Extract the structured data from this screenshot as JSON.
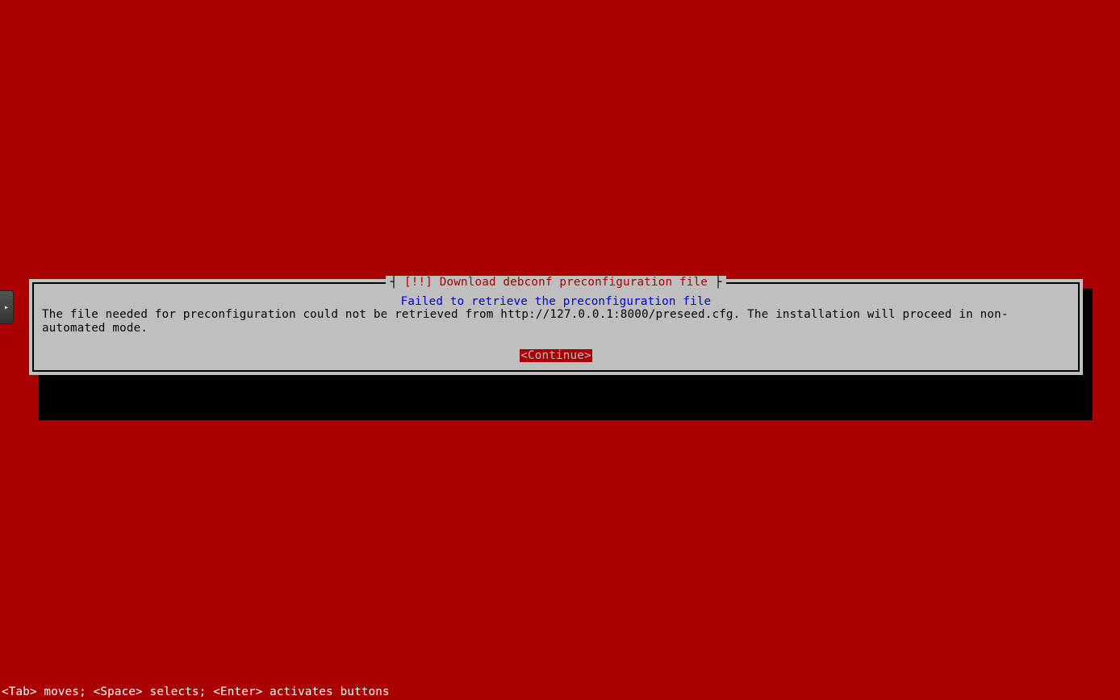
{
  "dialog": {
    "title": "[!!] Download debconf preconfiguration file",
    "subtitle": "Failed to retrieve the preconfiguration file",
    "body": "The file needed for preconfiguration could not be retrieved from http://127.0.0.1:8000/preseed.cfg. The installation will proceed in non-automated mode.",
    "continue_label": "<Continue>"
  },
  "footer": {
    "hint": "<Tab> moves; <Space> selects; <Enter> activates buttons"
  },
  "side_tab": {
    "glyph": "▸"
  }
}
